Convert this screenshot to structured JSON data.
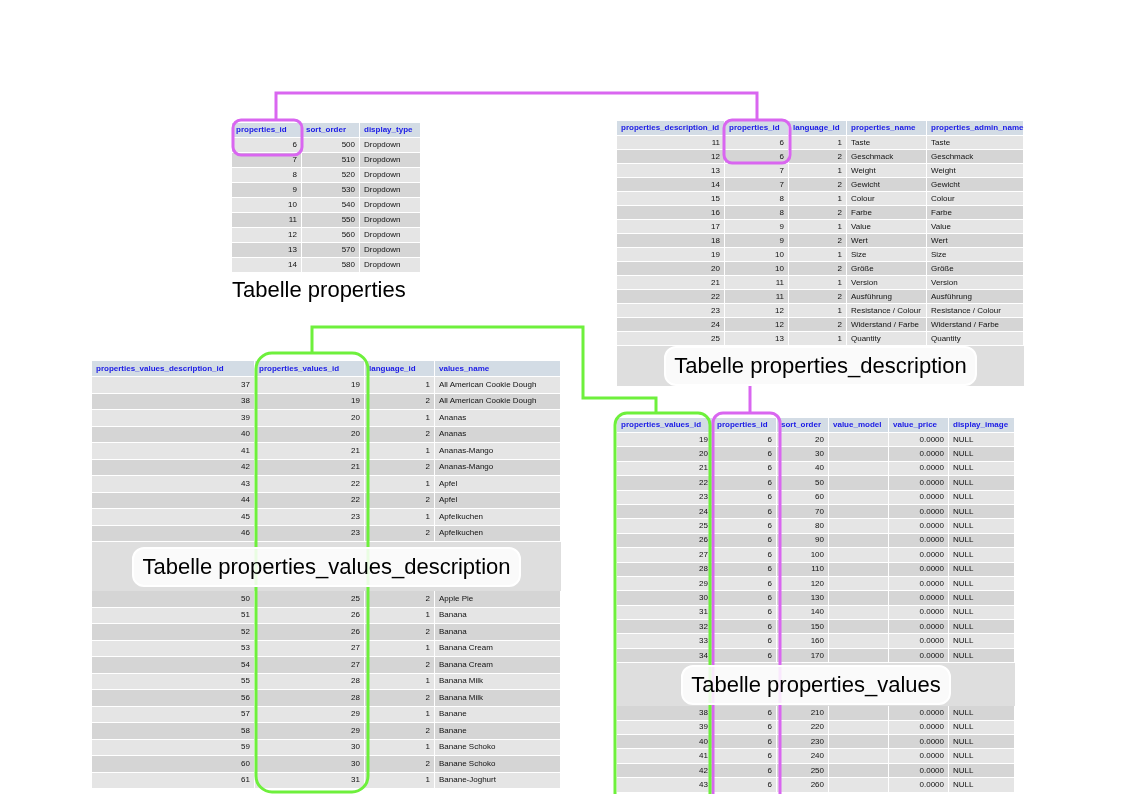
{
  "tables": [
    {
      "columns": [
        {
          "label": "properties_id",
          "kind": "number"
        },
        {
          "label": "sort_order",
          "kind": "number"
        },
        {
          "label": "display_type",
          "kind": "text"
        }
      ],
      "rows": [
        [
          "6",
          "500",
          "Dropdown"
        ],
        [
          "7",
          "510",
          "Dropdown"
        ],
        [
          "8",
          "520",
          "Dropdown"
        ],
        [
          "9",
          "530",
          "Dropdown"
        ],
        [
          "10",
          "540",
          "Dropdown"
        ],
        [
          "11",
          "550",
          "Dropdown"
        ],
        [
          "12",
          "560",
          "Dropdown"
        ],
        [
          "13",
          "570",
          "Dropdown"
        ],
        [
          "14",
          "580",
          "Dropdown"
        ]
      ],
      "caption": {
        "text": "Tabelle properties",
        "boxed": false
      }
    },
    {
      "columns": [
        {
          "label": "properties_description_id",
          "kind": "number"
        },
        {
          "label": "properties_id",
          "kind": "number"
        },
        {
          "label": "language_id",
          "kind": "number"
        },
        {
          "label": "properties_name",
          "kind": "text"
        },
        {
          "label": "properties_admin_name",
          "kind": "text"
        }
      ],
      "rows": [
        [
          "11",
          "6",
          "1",
          "Taste",
          "Taste"
        ],
        [
          "12",
          "6",
          "2",
          "Geschmack",
          "Geschmack"
        ],
        [
          "13",
          "7",
          "1",
          "Weight",
          "Weight"
        ],
        [
          "14",
          "7",
          "2",
          "Gewicht",
          "Gewicht"
        ],
        [
          "15",
          "8",
          "1",
          "Colour",
          "Colour"
        ],
        [
          "16",
          "8",
          "2",
          "Farbe",
          "Farbe"
        ],
        [
          "17",
          "9",
          "1",
          "Value",
          "Value"
        ],
        [
          "18",
          "9",
          "2",
          "Wert",
          "Wert"
        ],
        [
          "19",
          "10",
          "1",
          "Size",
          "Size"
        ],
        [
          "20",
          "10",
          "2",
          "Größe",
          "Größe"
        ],
        [
          "21",
          "11",
          "1",
          "Version",
          "Version"
        ],
        [
          "22",
          "11",
          "2",
          "Ausführung",
          "Ausführung"
        ],
        [
          "23",
          "12",
          "1",
          "Resistance / Colour",
          "Resistance / Colour"
        ],
        [
          "24",
          "12",
          "2",
          "Widerstand / Farbe",
          "Widerstand / Farbe"
        ],
        [
          "25",
          "13",
          "1",
          "Quantity",
          "Quantity"
        ]
      ],
      "caption": {
        "text": "Tabelle properties_description",
        "boxed": true
      }
    },
    {
      "columns": [
        {
          "label": "properties_values_description_id",
          "kind": "number"
        },
        {
          "label": "properties_values_id",
          "kind": "number"
        },
        {
          "label": "language_id",
          "kind": "number"
        },
        {
          "label": "values_name",
          "kind": "text"
        }
      ],
      "rows": [
        [
          "37",
          "19",
          "1",
          "All American Cookie Dough"
        ],
        [
          "38",
          "19",
          "2",
          "All American Cookie Dough"
        ],
        [
          "39",
          "20",
          "1",
          "Ananas"
        ],
        [
          "40",
          "20",
          "2",
          "Ananas"
        ],
        [
          "41",
          "21",
          "1",
          "Ananas-Mango"
        ],
        [
          "42",
          "21",
          "2",
          "Ananas-Mango"
        ],
        [
          "43",
          "22",
          "1",
          "Apfel"
        ],
        [
          "44",
          "22",
          "2",
          "Apfel"
        ],
        [
          "45",
          "23",
          "1",
          "Apfelkuchen"
        ],
        [
          "46",
          "23",
          "2",
          "Apfelkuchen"
        ]
      ],
      "caption": {
        "text": "Tabelle properties_values_description",
        "boxed": true
      },
      "rows_below_caption": [
        [
          "50",
          "25",
          "2",
          "Apple Pie"
        ],
        [
          "51",
          "26",
          "1",
          "Banana"
        ],
        [
          "52",
          "26",
          "2",
          "Banana"
        ],
        [
          "53",
          "27",
          "1",
          "Banana Cream"
        ],
        [
          "54",
          "27",
          "2",
          "Banana Cream"
        ],
        [
          "55",
          "28",
          "1",
          "Banana Milk"
        ],
        [
          "56",
          "28",
          "2",
          "Banana Milk"
        ],
        [
          "57",
          "29",
          "1",
          "Banane"
        ],
        [
          "58",
          "29",
          "2",
          "Banane"
        ],
        [
          "59",
          "30",
          "1",
          "Banane Schoko"
        ],
        [
          "60",
          "30",
          "2",
          "Banane Schoko"
        ],
        [
          "61",
          "31",
          "1",
          "Banane-Joghurt"
        ]
      ]
    },
    {
      "columns": [
        {
          "label": "properties_values_id",
          "kind": "number"
        },
        {
          "label": "properties_id",
          "kind": "number"
        },
        {
          "label": "sort_order",
          "kind": "number"
        },
        {
          "label": "value_model",
          "kind": "text"
        },
        {
          "label": "value_price",
          "kind": "number"
        },
        {
          "label": "display_image",
          "kind": "text"
        }
      ],
      "rows": [
        {
          "column_1": "19",
          "column_2": "6",
          "column_3": "20",
          "column_5": "0.0000",
          "column_6": "NULL"
        },
        {
          "column_1": "20",
          "column_2": "6",
          "column_3": "30",
          "column_5": "0.0000",
          "column_6": "NULL"
        },
        {
          "column_1": "21",
          "column_2": "6",
          "column_3": "40",
          "column_5": "0.0000",
          "column_6": "NULL"
        },
        {
          "column_1": "22",
          "column_2": "6",
          "column_3": "50",
          "column_5": "0.0000",
          "column_6": "NULL"
        },
        {
          "column_1": "23",
          "column_2": "6",
          "column_3": "60",
          "column_5": "0.0000",
          "column_6": "NULL"
        },
        {
          "column_1": "24",
          "column_2": "6",
          "column_3": "70",
          "column_5": "0.0000",
          "column_6": "NULL"
        },
        {
          "column_1": "25",
          "column_2": "6",
          "column_3": "80",
          "column_5": "0.0000",
          "column_6": "NULL"
        },
        {
          "column_1": "26",
          "column_2": "6",
          "column_3": "90",
          "column_5": "0.0000",
          "column_6": "NULL"
        },
        {
          "column_1": "27",
          "column_2": "6",
          "column_3": "100",
          "column_5": "0.0000",
          "column_6": "NULL"
        },
        {
          "column_1": "28",
          "column_2": "6",
          "column_3": "110",
          "column_5": "0.0000",
          "column_6": "NULL"
        },
        {
          "column_1": "29",
          "column_2": "6",
          "column_3": "120",
          "column_5": "0.0000",
          "column_6": "NULL"
        },
        {
          "column_1": "30",
          "column_2": "6",
          "column_3": "130",
          "column_5": "0.0000",
          "column_6": "NULL"
        },
        {
          "column_1": "31",
          "column_2": "6",
          "column_3": "140",
          "column_5": "0.0000",
          "column_6": "NULL"
        },
        {
          "column_1": "32",
          "column_2": "6",
          "column_3": "150",
          "column_5": "0.0000",
          "column_6": "NULL"
        },
        {
          "column_1": "33",
          "column_2": "6",
          "column_3": "160",
          "column_5": "0.0000",
          "column_6": "NULL"
        },
        {
          "column_1": "34",
          "column_2": "6",
          "column_3": "170",
          "column_5": "0.0000",
          "column_6": "NULL"
        }
      ],
      "caption": {
        "text": "Tabelle properties_values",
        "boxed": true
      },
      "rows_below_caption": [
        {
          "column_1": "38",
          "column_2": "6",
          "column_3": "210",
          "column_5": "0.0000",
          "column_6": "NULL"
        },
        {
          "column_1": "39",
          "column_2": "6",
          "column_3": "220",
          "column_5": "0.0000",
          "column_6": "NULL"
        },
        {
          "column_1": "40",
          "column_2": "6",
          "column_3": "230",
          "column_5": "0.0000",
          "column_6": "NULL"
        },
        {
          "column_1": "41",
          "column_2": "6",
          "column_3": "240",
          "column_5": "0.0000",
          "column_6": "NULL"
        },
        {
          "column_1": "42",
          "column_2": "6",
          "column_3": "250",
          "column_5": "0.0000",
          "column_6": "NULL"
        },
        {
          "column_1": "43",
          "column_2": "6",
          "column_3": "260",
          "column_5": "0.0000",
          "column_6": "NULL"
        }
      ]
    }
  ]
}
